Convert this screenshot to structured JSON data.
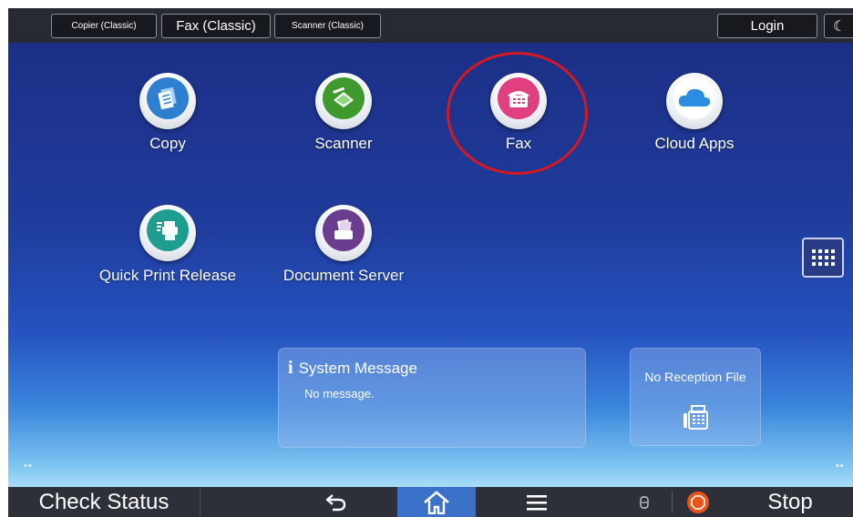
{
  "topbar": {
    "tabs": [
      {
        "label": "Copier (Classic)"
      },
      {
        "label": "Fax (Classic)"
      },
      {
        "label": "Scanner (Classic)"
      }
    ],
    "login_label": "Login",
    "mode_icon": "moon-icon"
  },
  "apps": [
    {
      "label": "Copy",
      "icon": "copy-icon",
      "color": "#2f7fd0"
    },
    {
      "label": "Scanner",
      "icon": "scanner-icon",
      "color": "#3e9a2c"
    },
    {
      "label": "Fax",
      "icon": "fax-icon",
      "color": "#e0407f",
      "highlighted": true
    },
    {
      "label": "Cloud Apps",
      "icon": "cloud-icon",
      "color": "#2b8de0"
    },
    {
      "label": "Quick Print Release",
      "icon": "printer-icon",
      "color": "#1f9e90"
    },
    {
      "label": "Document Server",
      "icon": "document-server-icon",
      "color": "#6a3d8f"
    }
  ],
  "highlight_color": "#d41920",
  "app_list_button_icon": "app-grid-icon",
  "system_message": {
    "title": "System Message",
    "body": "No message."
  },
  "reception_widget": {
    "title": "No Reception File",
    "icon": "fax-reception-icon"
  },
  "pagination": {
    "left": "••",
    "right": "••"
  },
  "bottombar": {
    "check_status_label": "Check Status",
    "back_icon": "back-arrow-icon",
    "home_icon": "home-icon",
    "menu_icon": "menu-icon",
    "data_icon": "data-in-icon",
    "stop_icon": "stop-icon",
    "stop_label": "Stop",
    "home_active_color": "#3b71c9",
    "stop_color": "#e8551b"
  }
}
